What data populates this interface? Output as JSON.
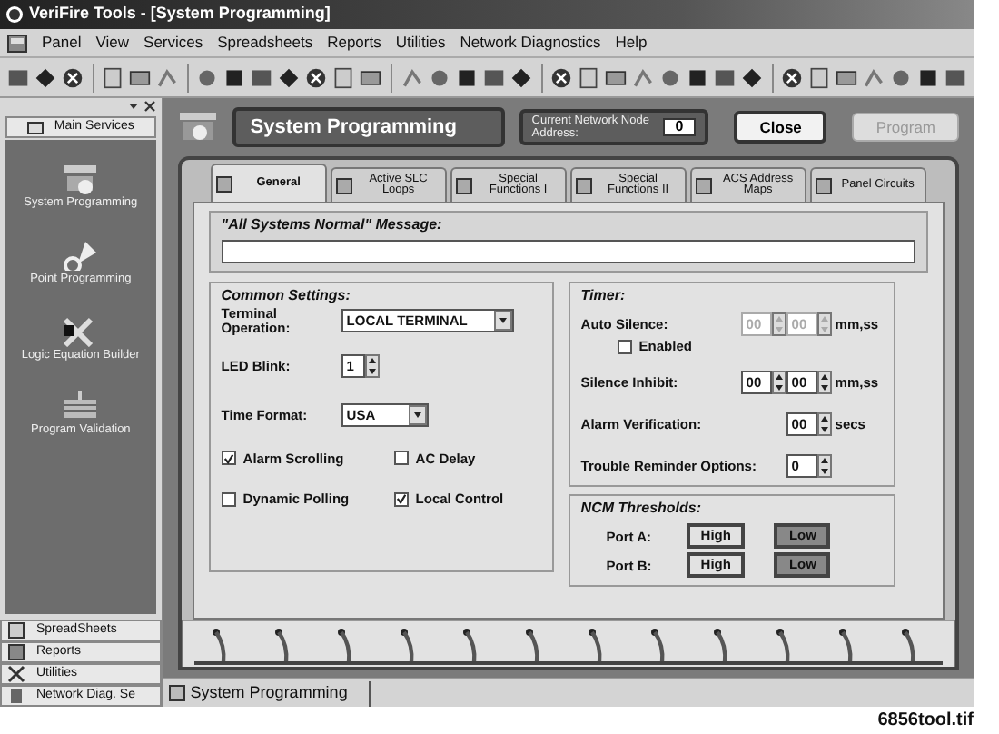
{
  "window": {
    "title": "VeriFire Tools - [System Programming]"
  },
  "menu": [
    "Panel",
    "View",
    "Services",
    "Spreadsheets",
    "Reports",
    "Utilities",
    "Network Diagnostics",
    "Help"
  ],
  "sidebar": {
    "header": "Main Services",
    "items": [
      {
        "label": "System Programming",
        "kind": "programming"
      },
      {
        "label": "Point Programming",
        "kind": "point"
      },
      {
        "label": "Logic Equation Builder",
        "kind": "logic"
      },
      {
        "label": "Program Validation",
        "kind": "validation"
      }
    ],
    "sections": [
      "SpreadSheets",
      "Reports",
      "Utilities",
      "Network Diag. Se"
    ]
  },
  "header": {
    "title": "System Programming",
    "node_label": "Current Network Node Address:",
    "node_value": "0",
    "buttons": [
      {
        "label": "Close",
        "disabled": false
      },
      {
        "label": "Program",
        "disabled": true
      }
    ]
  },
  "tabs": [
    {
      "label": "General",
      "selected": true
    },
    {
      "label": "Active SLC Loops",
      "selected": false
    },
    {
      "label": "Special Functions I",
      "selected": false
    },
    {
      "label": "Special Functions II",
      "selected": false
    },
    {
      "label": "ACS Address Maps",
      "selected": false
    },
    {
      "label": "Panel Circuits",
      "selected": false
    }
  ],
  "message": {
    "label": "\"All Systems Normal\" Message:"
  },
  "common_settings": {
    "title": "Common Settings:",
    "terminal_operation": {
      "label": "Terminal Operation:",
      "value": "LOCAL TERMINAL"
    },
    "led_blink": {
      "label": "LED Blink:",
      "value": "1"
    },
    "time_format": {
      "label": "Time Format:",
      "value": "USA"
    },
    "checkboxes": [
      {
        "label": "Alarm Scrolling",
        "checked": true
      },
      {
        "label": "AC Delay",
        "checked": false
      },
      {
        "label": "Dynamic Polling",
        "checked": false
      },
      {
        "label": "Local Control",
        "checked": true
      }
    ]
  },
  "timer": {
    "title": "Timer:",
    "auto_silence": {
      "label": "Auto Silence:",
      "minutes": "00",
      "seconds": "00",
      "unit": "mm,ss",
      "disabled": true,
      "enabled": {
        "label": "Enabled",
        "checked": false
      }
    },
    "silence_inhibit": {
      "label": "Silence Inhibit:",
      "minutes": "00",
      "seconds": "00",
      "unit": "mm,ss",
      "disabled": false
    },
    "alarm_verification": {
      "label": "Alarm Verification:",
      "value": "00",
      "unit": "secs"
    },
    "trouble_reminder": {
      "label": "Trouble  Reminder Options:",
      "value": "0"
    }
  },
  "ncm_thresholds": {
    "title": "NCM Thresholds:",
    "ports": [
      {
        "label": "Port A:",
        "options": [
          {
            "label": "High",
            "selected": false
          },
          {
            "label": "Low",
            "selected": true
          }
        ]
      },
      {
        "label": "Port B:",
        "options": [
          {
            "label": "High",
            "selected": false
          },
          {
            "label": "Low",
            "selected": true
          }
        ]
      }
    ]
  },
  "status_bar": {
    "task": "System Programming"
  },
  "figure_caption": "6856tool.tif"
}
